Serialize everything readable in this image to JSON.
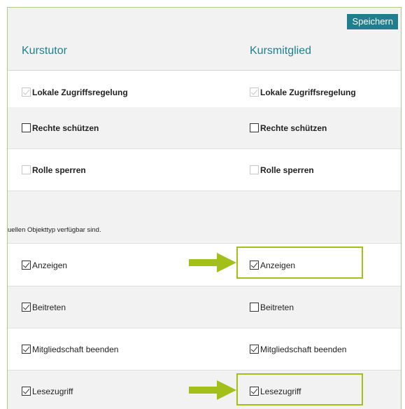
{
  "toolbar": {
    "save_label": "Speichern"
  },
  "columns": {
    "tutor": "Kurstutor",
    "member": "Kursmitglied"
  },
  "settings_rows": [
    {
      "label": "Lokale Zugriffsregelung",
      "tutor_checked": true,
      "tutor_disabled": true,
      "member_checked": true,
      "member_disabled": true
    },
    {
      "label": "Rechte schützen",
      "tutor_checked": false,
      "tutor_disabled": false,
      "member_checked": false,
      "member_disabled": false
    },
    {
      "label": "Rolle sperren",
      "tutor_checked": false,
      "tutor_disabled": true,
      "member_checked": false,
      "member_disabled": true
    }
  ],
  "note": "uellen Objekttyp verfügbar sind.",
  "permission_rows": [
    {
      "label": "Anzeigen",
      "tutor_checked": true,
      "member_checked": true,
      "highlighted": true
    },
    {
      "label": "Beitreten",
      "tutor_checked": true,
      "member_checked": false,
      "highlighted": false
    },
    {
      "label": "Mitgliedschaft beenden",
      "tutor_checked": true,
      "member_checked": true,
      "highlighted": false
    },
    {
      "label": "Lesezugriff",
      "tutor_checked": true,
      "member_checked": true,
      "highlighted": true
    }
  ],
  "colors": {
    "accent": "#1f7f8f",
    "highlight": "#a3bf1a"
  }
}
